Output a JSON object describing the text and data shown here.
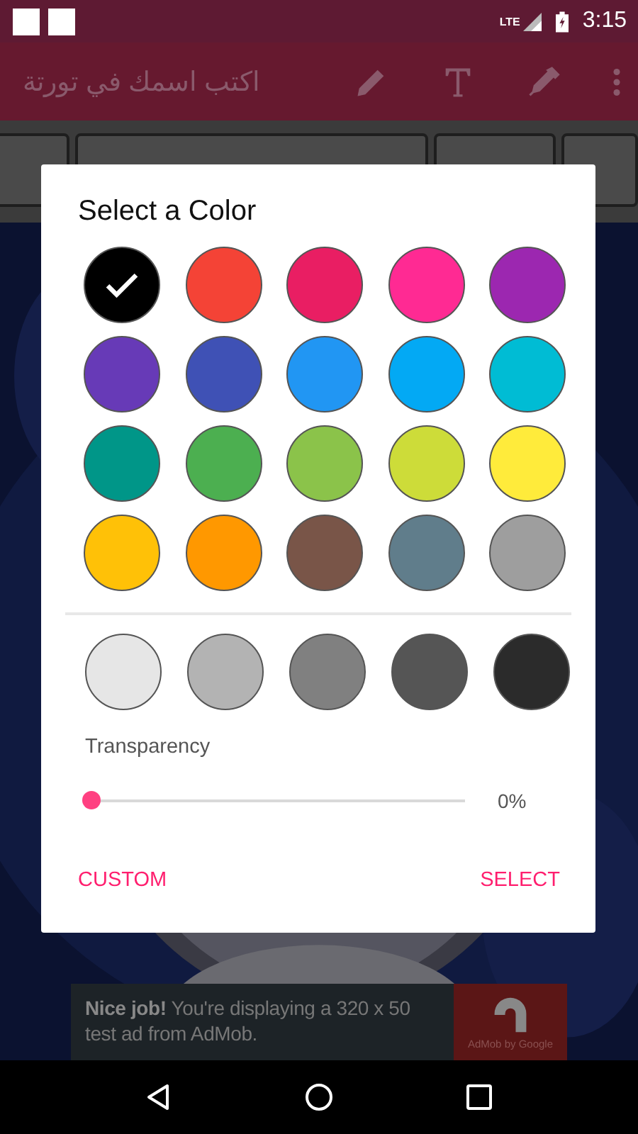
{
  "status_bar": {
    "time": "3:15",
    "network": "LTE"
  },
  "toolbar": {
    "title": "اكتب اسمك في تورتة"
  },
  "font_chips": [
    {
      "selected": false
    },
    {
      "selected": false
    },
    {
      "selected": false
    },
    {
      "selected": false
    }
  ],
  "dialog": {
    "title": "Select a Color",
    "colors": [
      {
        "color": "#000000",
        "selected": true
      },
      {
        "color": "#f44336",
        "selected": false
      },
      {
        "color": "#e91e63",
        "selected": false
      },
      {
        "color": "#ff2a93",
        "selected": false
      },
      {
        "color": "#9c27b0",
        "selected": false
      },
      {
        "color": "#673ab7",
        "selected": false
      },
      {
        "color": "#3f51b5",
        "selected": false
      },
      {
        "color": "#2196f3",
        "selected": false
      },
      {
        "color": "#03a9f4",
        "selected": false
      },
      {
        "color": "#00bcd4",
        "selected": false
      },
      {
        "color": "#009688",
        "selected": false
      },
      {
        "color": "#4caf50",
        "selected": false
      },
      {
        "color": "#8bc34a",
        "selected": false
      },
      {
        "color": "#cddc39",
        "selected": false
      },
      {
        "color": "#ffeb3b",
        "selected": false
      },
      {
        "color": "#ffc107",
        "selected": false
      },
      {
        "color": "#ff9800",
        "selected": false
      },
      {
        "color": "#795548",
        "selected": false
      },
      {
        "color": "#607d8b",
        "selected": false
      },
      {
        "color": "#9e9e9e",
        "selected": false
      }
    ],
    "grays": [
      {
        "color": "#e6e6e6",
        "selected": false
      },
      {
        "color": "#b3b3b3",
        "selected": false
      },
      {
        "color": "#808080",
        "selected": false
      },
      {
        "color": "#555555",
        "selected": false
      },
      {
        "color": "#2b2b2b",
        "selected": false
      }
    ],
    "transparency": {
      "label": "Transparency",
      "level": 0,
      "reading": "0%"
    },
    "buttons": [
      "CUSTOM",
      "SELECT"
    ]
  },
  "ad": {
    "text": "**Nice job!** You're displaying a 320 x 50 test ad from AdMob.",
    "logo_caption": "AdMob by Google"
  }
}
